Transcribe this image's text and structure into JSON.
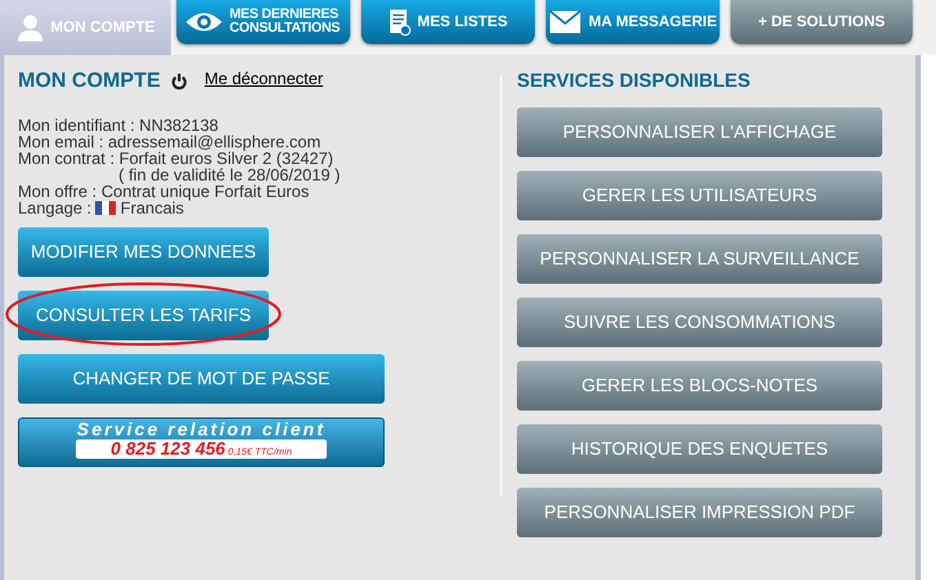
{
  "tabs": [
    {
      "label": "MON COMPTE",
      "kind": "account",
      "selected": true
    },
    {
      "label": "MES DERNIERES CONSULTATIONS",
      "kind": "primary",
      "selected": false
    },
    {
      "label": "MES LISTES",
      "kind": "primary",
      "selected": false
    },
    {
      "label": "MA MESSAGERIE",
      "kind": "primary",
      "selected": false
    },
    {
      "label": "+ DE SOLUTIONS",
      "kind": "secondary",
      "selected": false
    }
  ],
  "account": {
    "title": "MON COMPTE",
    "logout": "Me déconnecter",
    "info": [
      "Mon identifiant : NN382138",
      "Mon email : adressemail@ellisphere.com",
      "Mon contrat : Forfait euros Silver 2 (32427)",
      "( fin de validité le 28/06/2019 )",
      "Mon offre : Contrat unique Forfait Euros"
    ],
    "language_label": "Langage :",
    "language": "Francais",
    "buttons": [
      {
        "label": "MODIFIER MES DONNEES",
        "kind": "short",
        "highlighted": false
      },
      {
        "label": "CONSULTER LES TARIFS",
        "kind": "short",
        "highlighted": true
      },
      {
        "label": "CHANGER DE MOT DE PASSE",
        "kind": "wide",
        "highlighted": false
      }
    ],
    "contact": {
      "title": "Service relation client",
      "phone": "0 825 123 456",
      "price": "0,15€ TTC/min"
    }
  },
  "services": {
    "title": "SERVICES DISPONIBLES",
    "buttons": [
      "PERSONNALISER L'AFFICHAGE",
      "GERER LES UTILISATEURS",
      "PERSONNALISER LA SURVEILLANCE",
      "SUIVRE LES CONSOMMATIONS",
      "GERER LES BLOCS-NOTES",
      "HISTORIQUE DES ENQUETES",
      "PERSONNALISER IMPRESSION PDF"
    ]
  }
}
